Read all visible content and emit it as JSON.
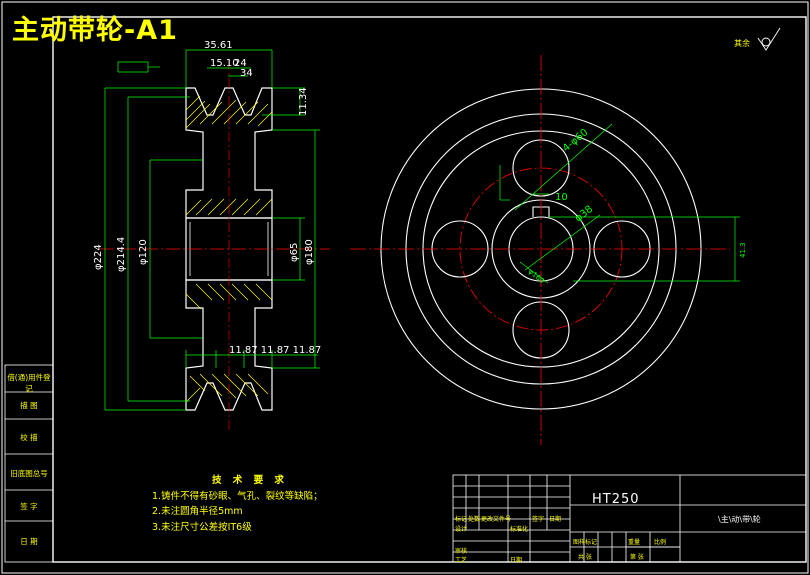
{
  "title": "主动带轮-A1",
  "material": "HT250",
  "drawing_name": "\\主\\动\\带\\轮",
  "roughness_note": "其余",
  "tech_requirements": {
    "heading": "技 术 要 求",
    "items": [
      "1.铸件不得有砂眼、气孔、裂纹等缺陷；",
      "2.未注圆角半径5mm",
      "3.未注尺寸公差按IT6级"
    ]
  },
  "side_column": [
    "借(通)用件登记",
    "描 图",
    "校 描",
    "旧底图总号",
    "签 字",
    "日 期"
  ],
  "title_block_labels": [
    "标记",
    "处数",
    "更改文件号",
    "签字",
    "日期",
    "设计",
    "标准化",
    "审核",
    "工艺",
    "日期",
    "图样标记",
    "重量",
    "比例",
    "共 张",
    "第 张"
  ],
  "dimensions": {
    "width_total": "35.61",
    "groove_pitch": "15.10",
    "groove_top": "24",
    "groove_width": "34",
    "groove_depth": "11.34",
    "dia_outer": "φ224",
    "dia_pitch": "φ214.4",
    "dia_hub": "φ120",
    "dia_bore": "φ65",
    "dia_hub2": "φ180",
    "edge_spacing": "11.87 11.87 11.87",
    "holes": "4-φ60",
    "keyway": "10",
    "bore_label": "φ38",
    "key_depth": "41.3",
    "circle_dia": "φ160"
  },
  "colors": {
    "background": "#000000",
    "outline": "#ffffff",
    "center_line": "#ff0000",
    "dimension": "#00ff00",
    "hatch": "#ffff00",
    "text": "#ffff00"
  }
}
